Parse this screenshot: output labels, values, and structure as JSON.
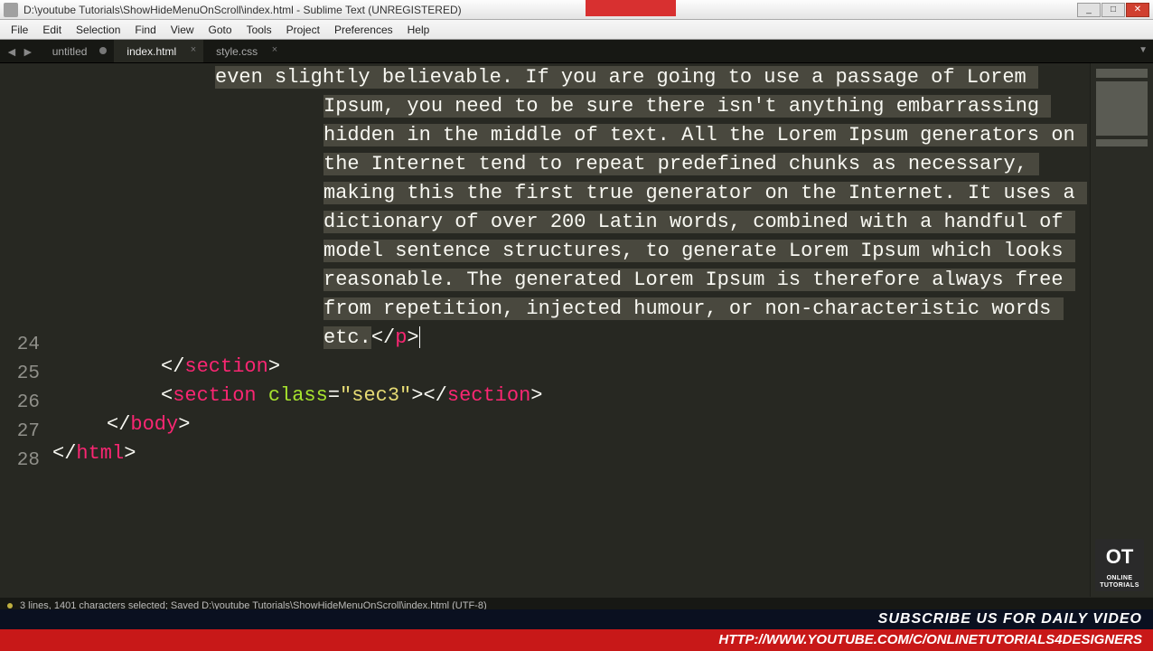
{
  "window": {
    "title": "D:\\youtube Tutorials\\ShowHideMenuOnScroll\\index.html - Sublime Text (UNREGISTERED)"
  },
  "menu": {
    "items": [
      "File",
      "Edit",
      "Selection",
      "Find",
      "View",
      "Goto",
      "Tools",
      "Project",
      "Preferences",
      "Help"
    ]
  },
  "tabs": [
    {
      "label": "untitled",
      "active": false,
      "dirty": true
    },
    {
      "label": "index.html",
      "active": true,
      "dirty": false
    },
    {
      "label": "style.css",
      "active": false,
      "dirty": false
    }
  ],
  "gutter": {
    "start": 24,
    "end": 28
  },
  "code": {
    "selected_paragraph": "even slightly believable. If you are going to use a passage of Lorem Ipsum, you need to be sure there isn't anything embarrassing hidden in the middle of text. All the Lorem Ipsum generators on the Internet tend to repeat predefined chunks as necessary, making this the first true generator on the Internet. It uses a dictionary of over 200 Latin words, combined with a handful of model sentence structures, to generate Lorem Ipsum which looks reasonable. The generated Lorem Ipsum is therefore always free from repetition, injected humour, or non-characteristic words etc.",
    "close_p_open": "</",
    "close_p_tag": "p",
    "close_p_end": ">",
    "l24_a": "</",
    "l24_tag": "section",
    "l24_b": ">",
    "l25_a": "<",
    "l25_tag1": "section",
    "l25_sp": " ",
    "l25_attr": "class",
    "l25_eq": "=",
    "l25_str": "\"sec3\"",
    "l25_b": "></",
    "l25_tag2": "section",
    "l25_c": ">",
    "l26_a": "</",
    "l26_tag": "body",
    "l26_b": ">",
    "l27_a": "</",
    "l27_tag": "html",
    "l27_b": ">"
  },
  "status": {
    "text": "3 lines, 1401 characters selected; Saved D:\\youtube Tutorials\\ShowHideMenuOnScroll\\index.html (UTF-8)"
  },
  "banner": {
    "top": "SUBSCRIBE US FOR DAILY VIDEO",
    "bot": "HTTP://WWW.YOUTUBE.COM/C/ONLINETUTORIALS4DESIGNERS"
  },
  "logo": {
    "main": "OT",
    "sub": "ONLINE TUTORIALS"
  }
}
